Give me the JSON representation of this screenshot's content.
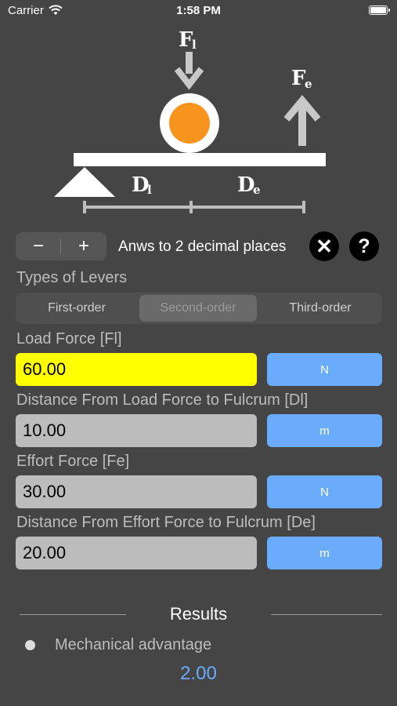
{
  "status_bar": {
    "carrier": "Carrier",
    "time": "1:58 PM"
  },
  "diagram": {
    "load_force_label": "F",
    "load_force_subscript": "l",
    "effort_force_label": "F",
    "effort_force_subscript": "e",
    "load_distance_label": "D",
    "load_distance_subscript": "l",
    "effort_distance_label": "D",
    "effort_distance_subscript": "e",
    "ball_color": "#f7941d"
  },
  "controls": {
    "minus_label": "−",
    "plus_label": "+",
    "decimals_text": "Anws to 2 decimal places",
    "clear_label": "✕",
    "help_label": "?"
  },
  "lever_types": {
    "label": "Types of Levers",
    "options": [
      "First-order",
      "Second-order",
      "Third-order"
    ],
    "selected": "Second-order"
  },
  "fields": [
    {
      "label": "Load Force [Fl]",
      "value": "60.00",
      "unit": "N"
    },
    {
      "label": "Distance From Load Force to Fulcrum [Dl]",
      "value": "10.00",
      "unit": "m"
    },
    {
      "label": "Effort Force [Fe]",
      "value": "30.00",
      "unit": "N"
    },
    {
      "label": "Distance From Effort Force to Fulcrum [De]",
      "value": "20.00",
      "unit": "m"
    }
  ],
  "results": {
    "title": "Results",
    "items": [
      {
        "label": "Mechanical advantage",
        "value": "2.00"
      }
    ]
  },
  "colors": {
    "background": "#454545",
    "active_field": "#ffff00",
    "unit_button": "#6aacfb",
    "result_value": "#6aacfb"
  }
}
